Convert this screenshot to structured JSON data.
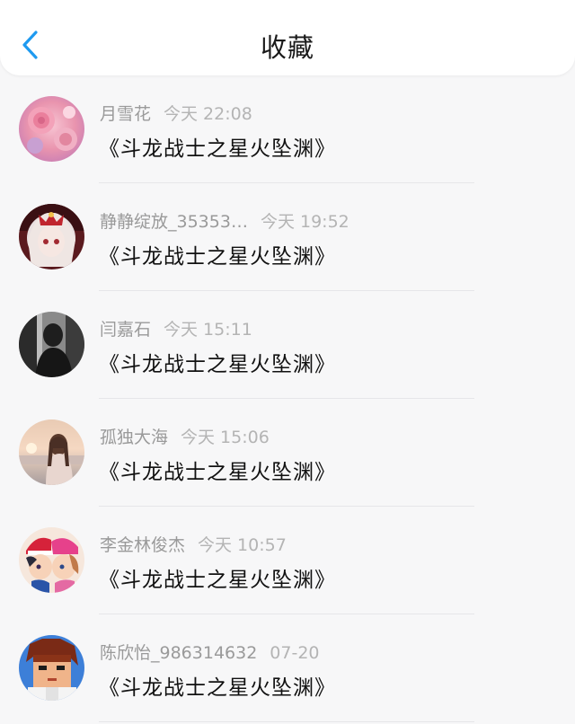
{
  "header": {
    "title": "收藏",
    "back_icon": "chevron-left-icon",
    "accent_color": "#1e9af0"
  },
  "favorites": [
    {
      "username": "月雪花",
      "time": "今天 22:08",
      "content": "《斗龙战士之星火坠渊》",
      "avatar": "pink-roses-avatar"
    },
    {
      "username": "静静绽放_35353…",
      "time": "今天 19:52",
      "content": "《斗龙战士之星火坠渊》",
      "avatar": "anime-girl-red-avatar"
    },
    {
      "username": "闫嘉石",
      "time": "今天 15:11",
      "content": "《斗龙战士之星火坠渊》",
      "avatar": "dark-figure-avatar"
    },
    {
      "username": "孤独大海",
      "time": "今天 15:06",
      "content": "《斗龙战士之星火坠渊》",
      "avatar": "sunset-girl-avatar"
    },
    {
      "username": "李金林俊杰",
      "time": "今天 10:57",
      "content": "《斗龙战士之星火坠渊》",
      "avatar": "cartoon-couple-avatar"
    },
    {
      "username": "陈欣怡_986314632",
      "time": "07-20",
      "content": "《斗龙战士之星火坠渊》",
      "avatar": "pixel-boy-avatar"
    }
  ]
}
